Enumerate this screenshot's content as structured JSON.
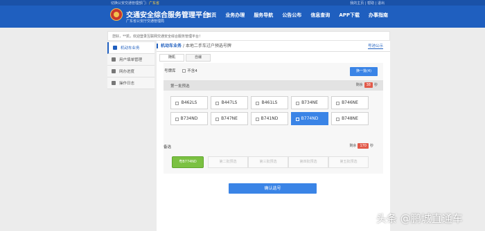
{
  "topbar": {
    "left_text": "切换公安交通管理部门：",
    "province": "广东省",
    "right_text": "我的主页 | 帮助 | 退出"
  },
  "site": {
    "title": "交通安全综合服务管理平台",
    "subtitle": "广东省公安厅交通管理局"
  },
  "nav": [
    "首页",
    "业务办理",
    "服务导航",
    "公告公布",
    "信息查询",
    "APP下载",
    "办事指南"
  ],
  "notice": "您好，**凯，欢迎登录互联网交通安全综合服务管理平台！",
  "sidebar": [
    "机动车业务",
    "用户填单管理",
    "网办进度",
    "操作日志"
  ],
  "breadcrumb": {
    "section": "机动车业务",
    "sep": "/",
    "page": "本地二手车过户预选号牌",
    "right": "号池公示"
  },
  "tabs": [
    "随机",
    "自编"
  ],
  "pool": {
    "label": "号牌库",
    "option": "不含4",
    "swap_button": "换一批(4)"
  },
  "group": {
    "label": "第一批预选",
    "timer_prefix": "剩余",
    "timer_value": "38",
    "timer_suffix": "秒"
  },
  "plates": [
    "B462LS",
    "B447LS",
    "B461LS",
    "B734NE",
    "B746NE",
    "B734ND",
    "B747NE",
    "B741ND",
    "B774ND",
    "B748NE"
  ],
  "selected_plate_index": 8,
  "selection": {
    "label": "备选",
    "timer_prefix": "剩余",
    "timer_value": "170",
    "timer_suffix": "秒",
    "slots": [
      "粤B774ND",
      "第二批预选",
      "第三批预选",
      "第四批预选",
      "第五批预选"
    ]
  },
  "confirm_button": "确认选号",
  "watermark": "头条 @鹏城直通车"
}
